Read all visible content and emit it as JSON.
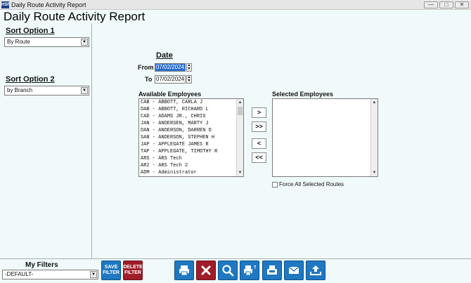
{
  "window": {
    "title": "Daily Route Activity Report",
    "logo_text": "HSF"
  },
  "report_title": "Daily Route Activity Report",
  "sort1": {
    "label": "Sort Option 1",
    "value": "By Route"
  },
  "sort2": {
    "label": "Sort Option 2",
    "value": "by Branch"
  },
  "date": {
    "heading": "Date",
    "from_label": "From",
    "from_value": "07/02/2024",
    "to_label": "To",
    "to_value": "07/02/2024"
  },
  "available": {
    "label": "Available Employees",
    "items": [
      "CAB - ABBOTT, CARLA J",
      "DAB - ABBOTT, RICHARD L",
      "CAD - ADAMS JR., CHRIS",
      "JAN - ANDERSEN, MARTY J",
      "DAN - ANDERSON, DARREN D",
      "SAN - ANDERSON, STEPHEN H",
      "JAP - APPLEGATE JAMES R",
      "TAP - APPLEGATE, TIMOTHY R",
      "ARS - ARS Tech",
      "AR2 - ARS Tech 2",
      "ADM - Administrator"
    ]
  },
  "selected": {
    "label": "Selected Employees",
    "items": []
  },
  "move_buttons": {
    "add": ">",
    "add_all": ">>",
    "remove": "<",
    "remove_all": "<<"
  },
  "force_label": "Force All Selected Routes",
  "filters": {
    "label": "My Filters",
    "value": "-DEFAULT-",
    "save": "SAVE FILTER",
    "delete": "DELETE FILTER"
  },
  "toolbar_icons": [
    "print-icon",
    "cancel-icon",
    "preview-icon",
    "print-options-icon",
    "fax-icon",
    "email-icon",
    "export-icon"
  ]
}
